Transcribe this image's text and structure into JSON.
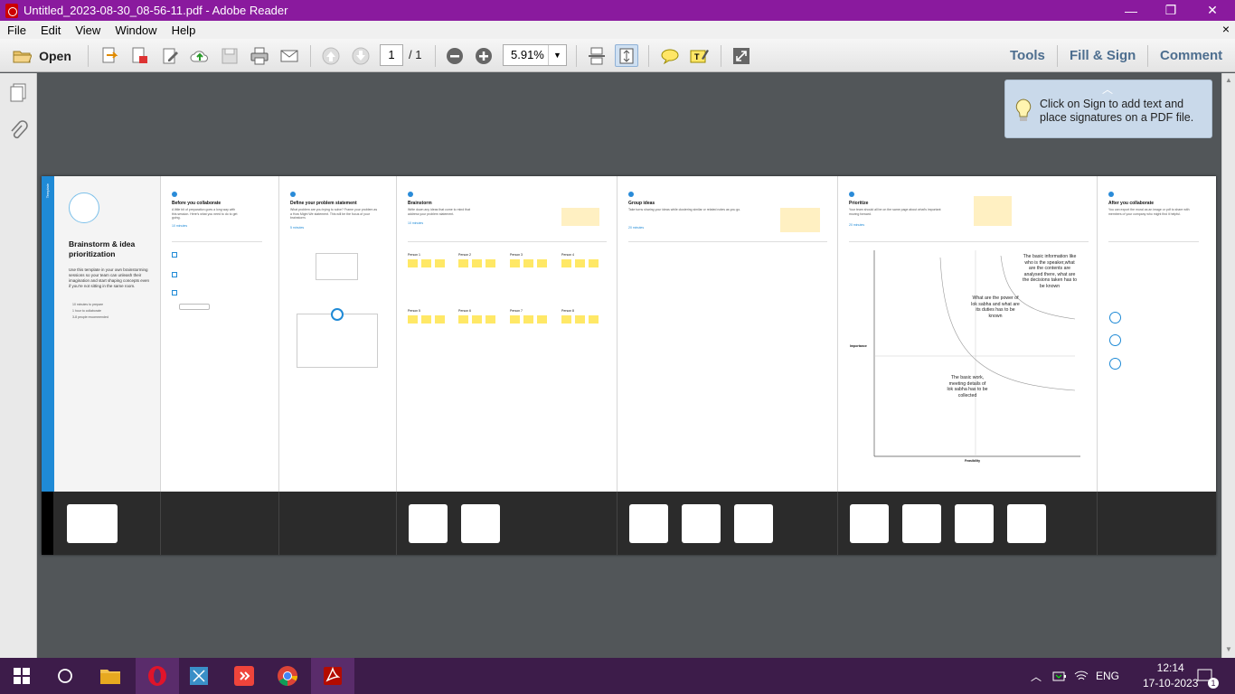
{
  "window": {
    "title": "Untitled_2023-08-30_08-56-11.pdf - Adobe Reader",
    "minimize": "—",
    "restore": "❐",
    "close": "✕"
  },
  "menu": {
    "items": [
      "File",
      "Edit",
      "View",
      "Window",
      "Help"
    ],
    "close": "×"
  },
  "toolbar": {
    "open_label": "Open",
    "page_current": "1",
    "page_total": "/ 1",
    "zoom": "5.91%",
    "tools_label": "Tools",
    "fillsign_label": "Fill & Sign",
    "comment_label": "Comment"
  },
  "tip": {
    "text": "Click on Sign to add text and place signatures on a PDF file."
  },
  "pdf": {
    "intro": {
      "tag": "Template",
      "title": "Brainstorm & idea prioritization",
      "desc": "Use this template in your own brainstorming sessions so your team can unleash their imagination and start shaping concepts even if you're not sitting in the same room.",
      "bullets": [
        "10 minutes to prepare",
        "1 hour to collaborate",
        "3-8 people recommended"
      ]
    },
    "sections": [
      {
        "title": "Before you collaborate",
        "desc": "A little bit of preparation goes a long way with this session. Here's what you need to do to get going.",
        "time": "10 minutes"
      },
      {
        "title": "Define your problem statement",
        "desc": "What problem are you trying to solve? Frame your problem as a How Might We statement. This will be the focus of your brainstorm.",
        "time": "5 minutes"
      },
      {
        "title": "Brainstorm",
        "desc": "Write down any ideas that come to mind that address your problem statement.",
        "time": "10 minutes"
      },
      {
        "title": "Group ideas",
        "desc": "Take turns sharing your ideas while clustering similar or related notes as you go.",
        "time": "20 minutes"
      },
      {
        "title": "Prioritize",
        "desc": "Your team should all be on the same page about what's important moving forward.",
        "time": "20 minutes"
      },
      {
        "title": "After you collaborate",
        "desc": "You can export the mural as an image or pdf to share with members of your company who might find it helpful."
      }
    ],
    "matrix": {
      "ylabel": "Importance",
      "xlabel": "Feasibility",
      "note1": "The basic information like who is the speaker,what are the contents are analysed there, what are the decisions taken has to be known",
      "note2": "What are the power of lok sabha and what are its duties has to be known",
      "note3": "The basic work, meeting details of lok sabha has to be collected"
    },
    "persons": [
      "Person 1",
      "Person 2",
      "Person 3",
      "Person 4",
      "Person 5",
      "Person 6",
      "Person 7",
      "Person 8"
    ]
  },
  "taskbar": {
    "lang": "ENG",
    "time": "12:14",
    "date": "17-10-2023",
    "notif_count": "1"
  }
}
